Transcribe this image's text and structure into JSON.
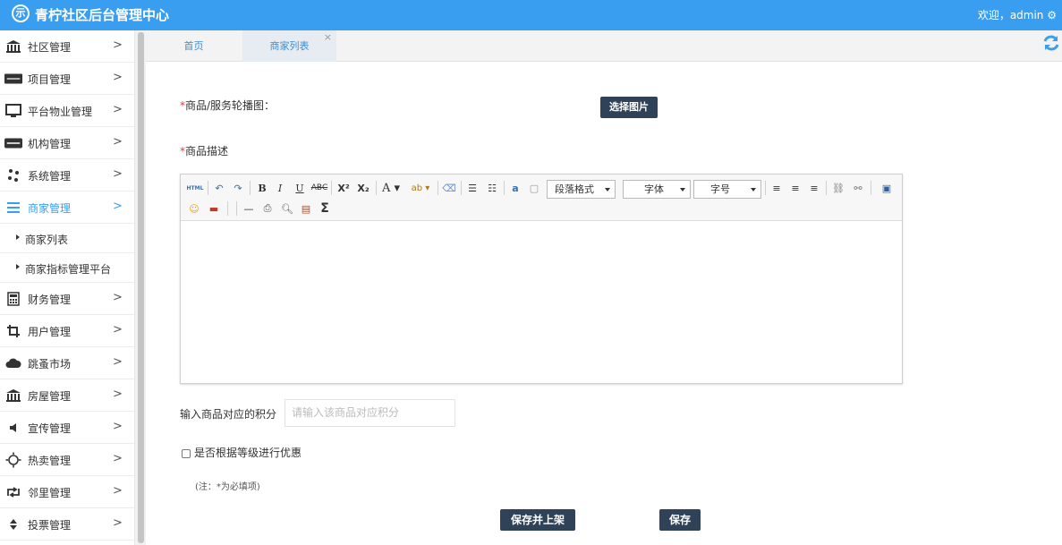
{
  "header": {
    "logo_char": "示",
    "title": "青柠社区后台管理中心",
    "welcome": "欢迎，admin ⚙"
  },
  "sidebar": {
    "items": [
      {
        "label": "社区管理",
        "icon": "bank-icon"
      },
      {
        "label": "项目管理",
        "icon": "discover-card-icon"
      },
      {
        "label": "平台物业管理",
        "icon": "desktop-icon"
      },
      {
        "label": "机构管理",
        "icon": "stripe-icon"
      },
      {
        "label": "系统管理",
        "icon": "slack-icon"
      },
      {
        "label": "商家管理",
        "icon": "bars-icon"
      },
      {
        "label": "财务管理",
        "icon": "calculator-icon"
      },
      {
        "label": "用户管理",
        "icon": "crop-icon"
      },
      {
        "label": "跳蚤市场",
        "icon": "cloud-icon"
      },
      {
        "label": "房屋管理",
        "icon": "bank-icon"
      },
      {
        "label": "宣传管理",
        "icon": "volume-icon"
      },
      {
        "label": "热卖管理",
        "icon": "sun-icon"
      },
      {
        "label": "邻里管理",
        "icon": "retweet-icon"
      },
      {
        "label": "投票管理",
        "icon": "sort-icon"
      }
    ],
    "subitems": [
      "商家列表",
      "商家指标管理平台"
    ]
  },
  "tabs": {
    "home": "首页",
    "current": "商家列表",
    "close": "×"
  },
  "form": {
    "carousel_label": "商品/服务轮播图：",
    "select_image": "选择图片",
    "desc_label": "商品描述",
    "required_mark": "*",
    "points_label": "输入商品对应的积分",
    "points_placeholder": "请输入该商品对应积分",
    "discount_label": "是否根据等级进行优惠",
    "note": "(注：*为必填项)",
    "save_publish": "保存并上架",
    "save": "保存"
  },
  "editor": {
    "paragraph_select": "段落格式",
    "font_select": "字体",
    "size_select": "字号",
    "html_label": "HTML"
  }
}
